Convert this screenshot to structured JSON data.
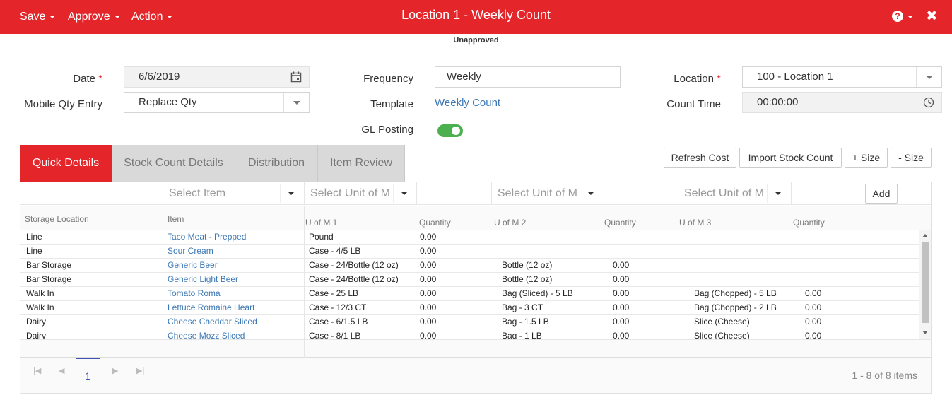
{
  "header": {
    "menus": [
      "Save",
      "Approve",
      "Action"
    ],
    "title": "Location 1 - Weekly Count",
    "help_icon": "?",
    "close_icon": "✖",
    "status": "Unapproved"
  },
  "form": {
    "date_label": "Date",
    "date_value": "6/6/2019",
    "mobile_label": "Mobile Qty Entry",
    "mobile_value": "Replace Qty",
    "frequency_label": "Frequency",
    "frequency_value": "Weekly",
    "template_label": "Template",
    "template_value": "Weekly Count",
    "gl_label": "GL Posting",
    "gl_on": true,
    "location_label": "Location",
    "location_value": "100 - Location 1",
    "counttime_label": "Count Time",
    "counttime_value": "00:00:00",
    "required_mark": "*"
  },
  "tabs": [
    "Quick Details",
    "Stock Count Details",
    "Distribution",
    "Item Review"
  ],
  "buttons": {
    "refresh": "Refresh Cost",
    "import": "Import Stock Count",
    "plus_size": "+ Size",
    "minus_size": "- Size"
  },
  "add_row": {
    "select_item": "Select Item",
    "select_uom_1": "Select Unit of M",
    "select_uom_2": "Select Unit of Me",
    "select_uom_3": "Select Unit of Me",
    "add": "Add"
  },
  "grid": {
    "headers": {
      "storage": "Storage Location",
      "item": "Item",
      "uom1": "U of M 1",
      "qty1": "Quantity",
      "uom2": "U of M 2",
      "qty2": "Quantity",
      "uom3": "U of M 3",
      "qty3": "Quantity"
    },
    "rows": [
      [
        "Line",
        "Taco Meat - Prepped",
        "Pound",
        "0.00",
        "",
        "",
        "",
        ""
      ],
      [
        "Line",
        "Sour Cream",
        "Case - 4/5 LB",
        "0.00",
        "",
        "",
        "",
        ""
      ],
      [
        "Bar Storage",
        "Generic Beer",
        "Case - 24/Bottle (12 oz)",
        "0.00",
        "Bottle (12 oz)",
        "0.00",
        "",
        ""
      ],
      [
        "Bar Storage",
        "Generic Light Beer",
        "Case - 24/Bottle (12 oz)",
        "0.00",
        "Bottle (12 oz)",
        "0.00",
        "",
        ""
      ],
      [
        "Walk In",
        "Tomato Roma",
        "Case - 25 LB",
        "0.00",
        "Bag (Sliced) - 5 LB",
        "0.00",
        "Bag (Chopped) - 5 LB",
        "0.00"
      ],
      [
        "Walk In",
        "Lettuce Romaine Heart",
        "Case - 12/3 CT",
        "0.00",
        "Bag - 3 CT",
        "0.00",
        "Bag (Chopped) - 2 LB",
        "0.00"
      ],
      [
        "Dairy",
        "Cheese Cheddar Sliced",
        "Case - 6/1.5 LB",
        "0.00",
        "Bag - 1.5 LB",
        "0.00",
        "Slice (Cheese)",
        "0.00"
      ],
      [
        "Dairy",
        "Cheese Mozz Sliced",
        "Case - 8/1 LB",
        "0.00",
        "Bag - 1 LB",
        "0.00",
        "Slice (Cheese)",
        "0.00"
      ]
    ]
  },
  "pager": {
    "page": "1",
    "info": "1 - 8 of 8 items"
  },
  "colors": {
    "brand_red": "#e4262b",
    "link_blue": "#3c78b5",
    "toggle_green": "#4caf50"
  }
}
